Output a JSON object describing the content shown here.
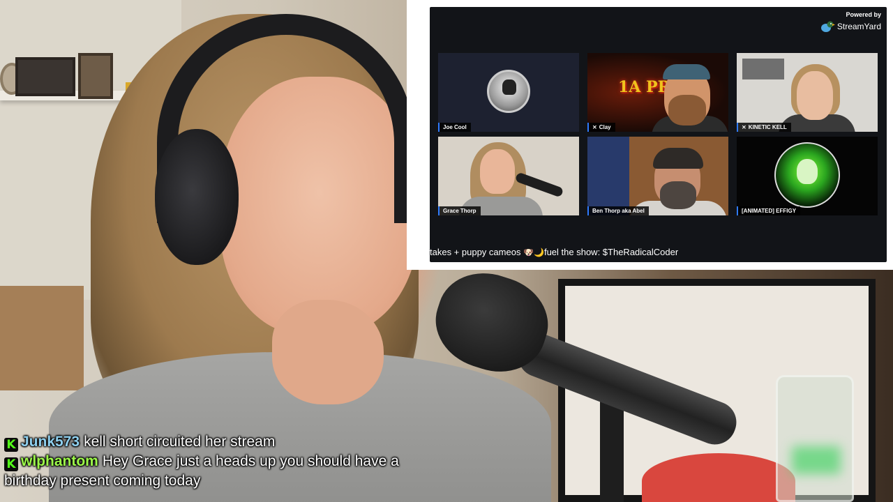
{
  "streamyard": {
    "powered_by": "Powered by",
    "brand": "StreamYard",
    "participants": [
      {
        "name": "Joe Cool",
        "muted": false
      },
      {
        "name": "Clay",
        "muted": true
      },
      {
        "name": "KINETIC KELL",
        "muted": true
      },
      {
        "name": "Grace Thorp",
        "muted": false
      },
      {
        "name": "Ben Thorp aka Abel",
        "muted": false
      },
      {
        "name": "[ANIMATED] EFFIGY",
        "muted": false
      }
    ],
    "clay_banner": "1A PR",
    "ticker_part1": "takes + puppy cameos ",
    "ticker_part2": "fuel the show: $TheRadicalCoder",
    "puppy_glyph": "🐶",
    "moon_glyph": "🌙"
  },
  "chat": {
    "badge_glyph": "K",
    "messages": [
      {
        "user": "Junk573",
        "user_color": "#8fd0ef",
        "text": "kell short circuited her stream"
      },
      {
        "user": "wlphantom",
        "user_color": "#9dfb4a",
        "text": "Hey Grace just a heads up you should have a birthday present coming today"
      }
    ]
  }
}
